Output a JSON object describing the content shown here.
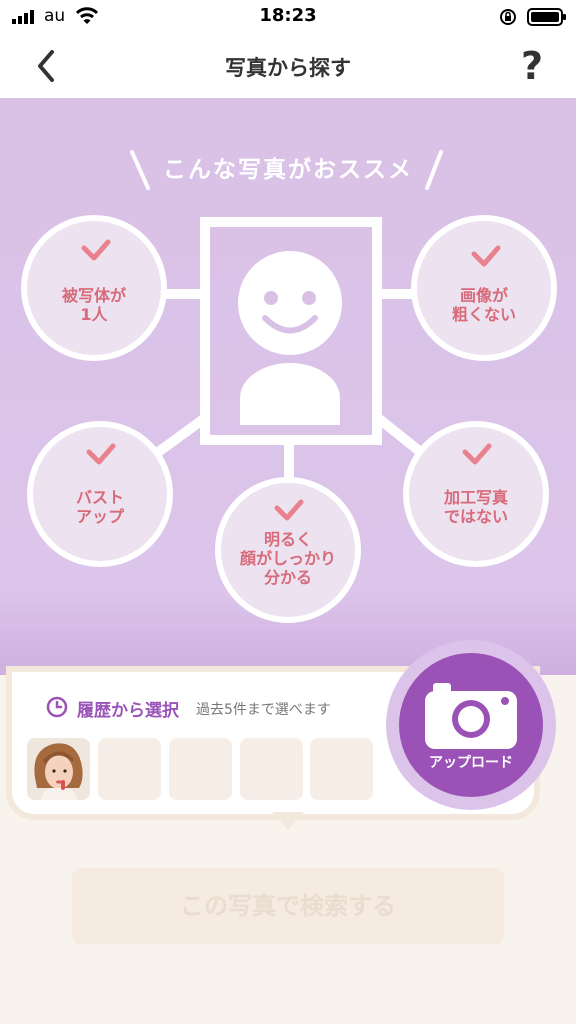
{
  "status_bar": {
    "carrier": "au",
    "time": "18:23"
  },
  "nav": {
    "title": "写真から探す",
    "help_label": "?"
  },
  "hero": {
    "title": "こんな写真がおススメ",
    "tips": [
      {
        "label": "被写体が\n1人"
      },
      {
        "label": "画像が\n粗くない"
      },
      {
        "label": "バスト\nアップ"
      },
      {
        "label": "加工写真\nではない"
      },
      {
        "label": "明るく\n顔がしっかり\n分かる"
      }
    ]
  },
  "history": {
    "title": "履歴から選択",
    "note": "過去5件まで選べます"
  },
  "upload": {
    "label": "アップロード"
  },
  "search_button": {
    "label": "この写真で検索する"
  },
  "colors": {
    "accent": "#9b52b6",
    "hero_bg": "#dcc5ea",
    "tip_text": "#d86a7a",
    "check": "#e9818f"
  }
}
